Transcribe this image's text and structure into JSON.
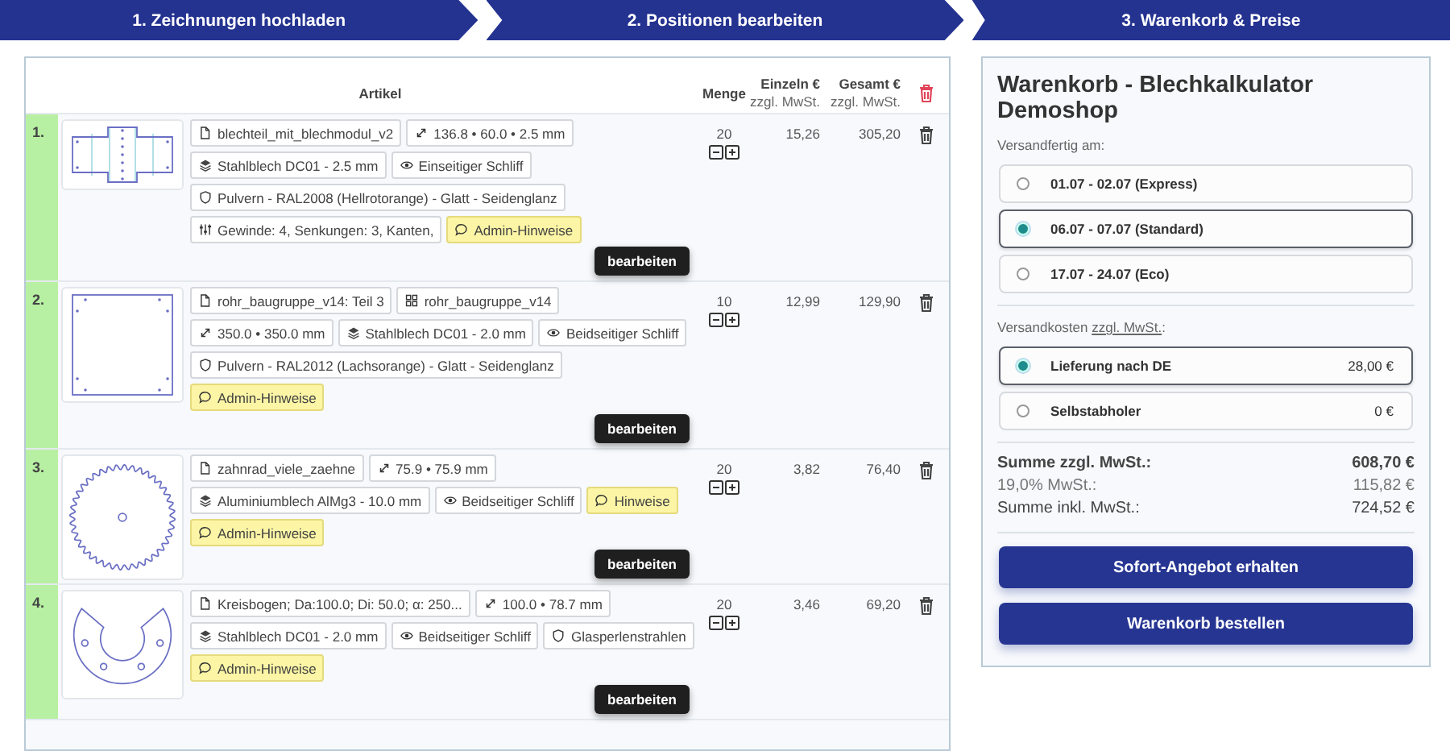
{
  "steps": [
    {
      "label": "1. Zeichnungen hochladen"
    },
    {
      "label": "2. Positionen bearbeiten"
    },
    {
      "label": "3. Warenkorb & Preise"
    }
  ],
  "table": {
    "columns": [
      {
        "label": "Artikel"
      },
      {
        "label": "Menge"
      },
      {
        "label": "Einzeln €",
        "note": "zzgl. MwSt."
      },
      {
        "label": "Gesamt €",
        "note": "zzgl. MwSt."
      }
    ],
    "rows": [
      {
        "number": "1.",
        "tags": [
          {
            "kind": "file",
            "text": "blechteil_mit_blechmodul_v2"
          },
          {
            "kind": "dims",
            "text": "136.8 • 60.0 • 2.5 mm"
          },
          {
            "kind": "material",
            "text": "Stahlblech DC01 - 2.5 mm"
          },
          {
            "kind": "finish",
            "text": "Einseitiger Schliff"
          },
          {
            "kind": "coating",
            "text": "Pulvern - RAL2008 (Hellrotorange) - Glatt - Seidenglanz"
          },
          {
            "kind": "features",
            "text": "Gewinde: 4, Senkungen: 3, Kanten,"
          },
          {
            "kind": "note",
            "text": "Admin-Hinweise"
          }
        ],
        "quantity": "20",
        "unit_price": "15,26",
        "total": "305,20",
        "edit": "bearbeiten"
      },
      {
        "number": "2.",
        "tags": [
          {
            "kind": "file",
            "text": "rohr_baugruppe_v14: Teil 3"
          },
          {
            "kind": "assembly",
            "text": "rohr_baugruppe_v14"
          },
          {
            "kind": "dims",
            "text": "350.0 • 350.0 mm"
          },
          {
            "kind": "material",
            "text": "Stahlblech DC01 - 2.0 mm"
          },
          {
            "kind": "finish",
            "text": "Beidseitiger Schliff"
          },
          {
            "kind": "coating",
            "text": "Pulvern - RAL2012 (Lachsorange) - Glatt - Seidenglanz"
          },
          {
            "kind": "note",
            "text": "Admin-Hinweise"
          }
        ],
        "quantity": "10",
        "unit_price": "12,99",
        "total": "129,90",
        "edit": "bearbeiten"
      },
      {
        "number": "3.",
        "tags": [
          {
            "kind": "file",
            "text": "zahnrad_viele_zaehne"
          },
          {
            "kind": "dims",
            "text": "75.9 • 75.9 mm"
          },
          {
            "kind": "material",
            "text": "Aluminiumblech AlMg3 - 10.0 mm"
          },
          {
            "kind": "finish",
            "text": "Beidseitiger Schliff"
          },
          {
            "kind": "note",
            "text": "Hinweise"
          },
          {
            "kind": "note",
            "text": "Admin-Hinweise"
          }
        ],
        "quantity": "20",
        "unit_price": "3,82",
        "total": "76,40",
        "edit": "bearbeiten"
      },
      {
        "number": "4.",
        "tags": [
          {
            "kind": "file",
            "text": "Kreisbogen; Da:100.0; Di: 50.0; α: 250..."
          },
          {
            "kind": "dims",
            "text": "100.0 • 78.7 mm"
          },
          {
            "kind": "material",
            "text": "Stahlblech DC01 - 2.0 mm"
          },
          {
            "kind": "finish",
            "text": "Beidseitiger Schliff"
          },
          {
            "kind": "coating",
            "text": "Glasperlenstrahlen"
          },
          {
            "kind": "note",
            "text": "Admin-Hinweise"
          }
        ],
        "quantity": "20",
        "unit_price": "3,46",
        "total": "69,20",
        "edit": "bearbeiten"
      }
    ]
  },
  "cart": {
    "title": "Warenkorb - Blechkalkulator Demoshop",
    "dates_label": "Versandfertig am:",
    "dates": [
      {
        "label": "01.07 - 02.07 (Express)",
        "selected": false
      },
      {
        "label": "06.07 - 07.07 (Standard)",
        "selected": true
      },
      {
        "label": "17.07 - 24.07 (Eco)",
        "selected": false
      }
    ],
    "shipping_label": {
      "text": "Versandkosten",
      "link": "zzgl. MwSt.",
      "suffix": ":"
    },
    "shipping": [
      {
        "label": "Lieferung nach DE",
        "price": "28,00 €",
        "selected": true
      },
      {
        "label": "Selbstabholer",
        "price": "0 €",
        "selected": false
      }
    ],
    "summary": [
      {
        "kind": "bold",
        "label": "Summe zzgl. MwSt.:",
        "value": "608,70 €"
      },
      {
        "kind": "muted",
        "label": "19,0% MwSt.:",
        "value": "115,82 €"
      },
      {
        "kind": "normal",
        "label": "Summe inkl. MwSt.:",
        "value": "724,52 €"
      }
    ],
    "buttons": [
      "Sofort-Angebot erhalten",
      "Warenkorb bestellen"
    ]
  }
}
